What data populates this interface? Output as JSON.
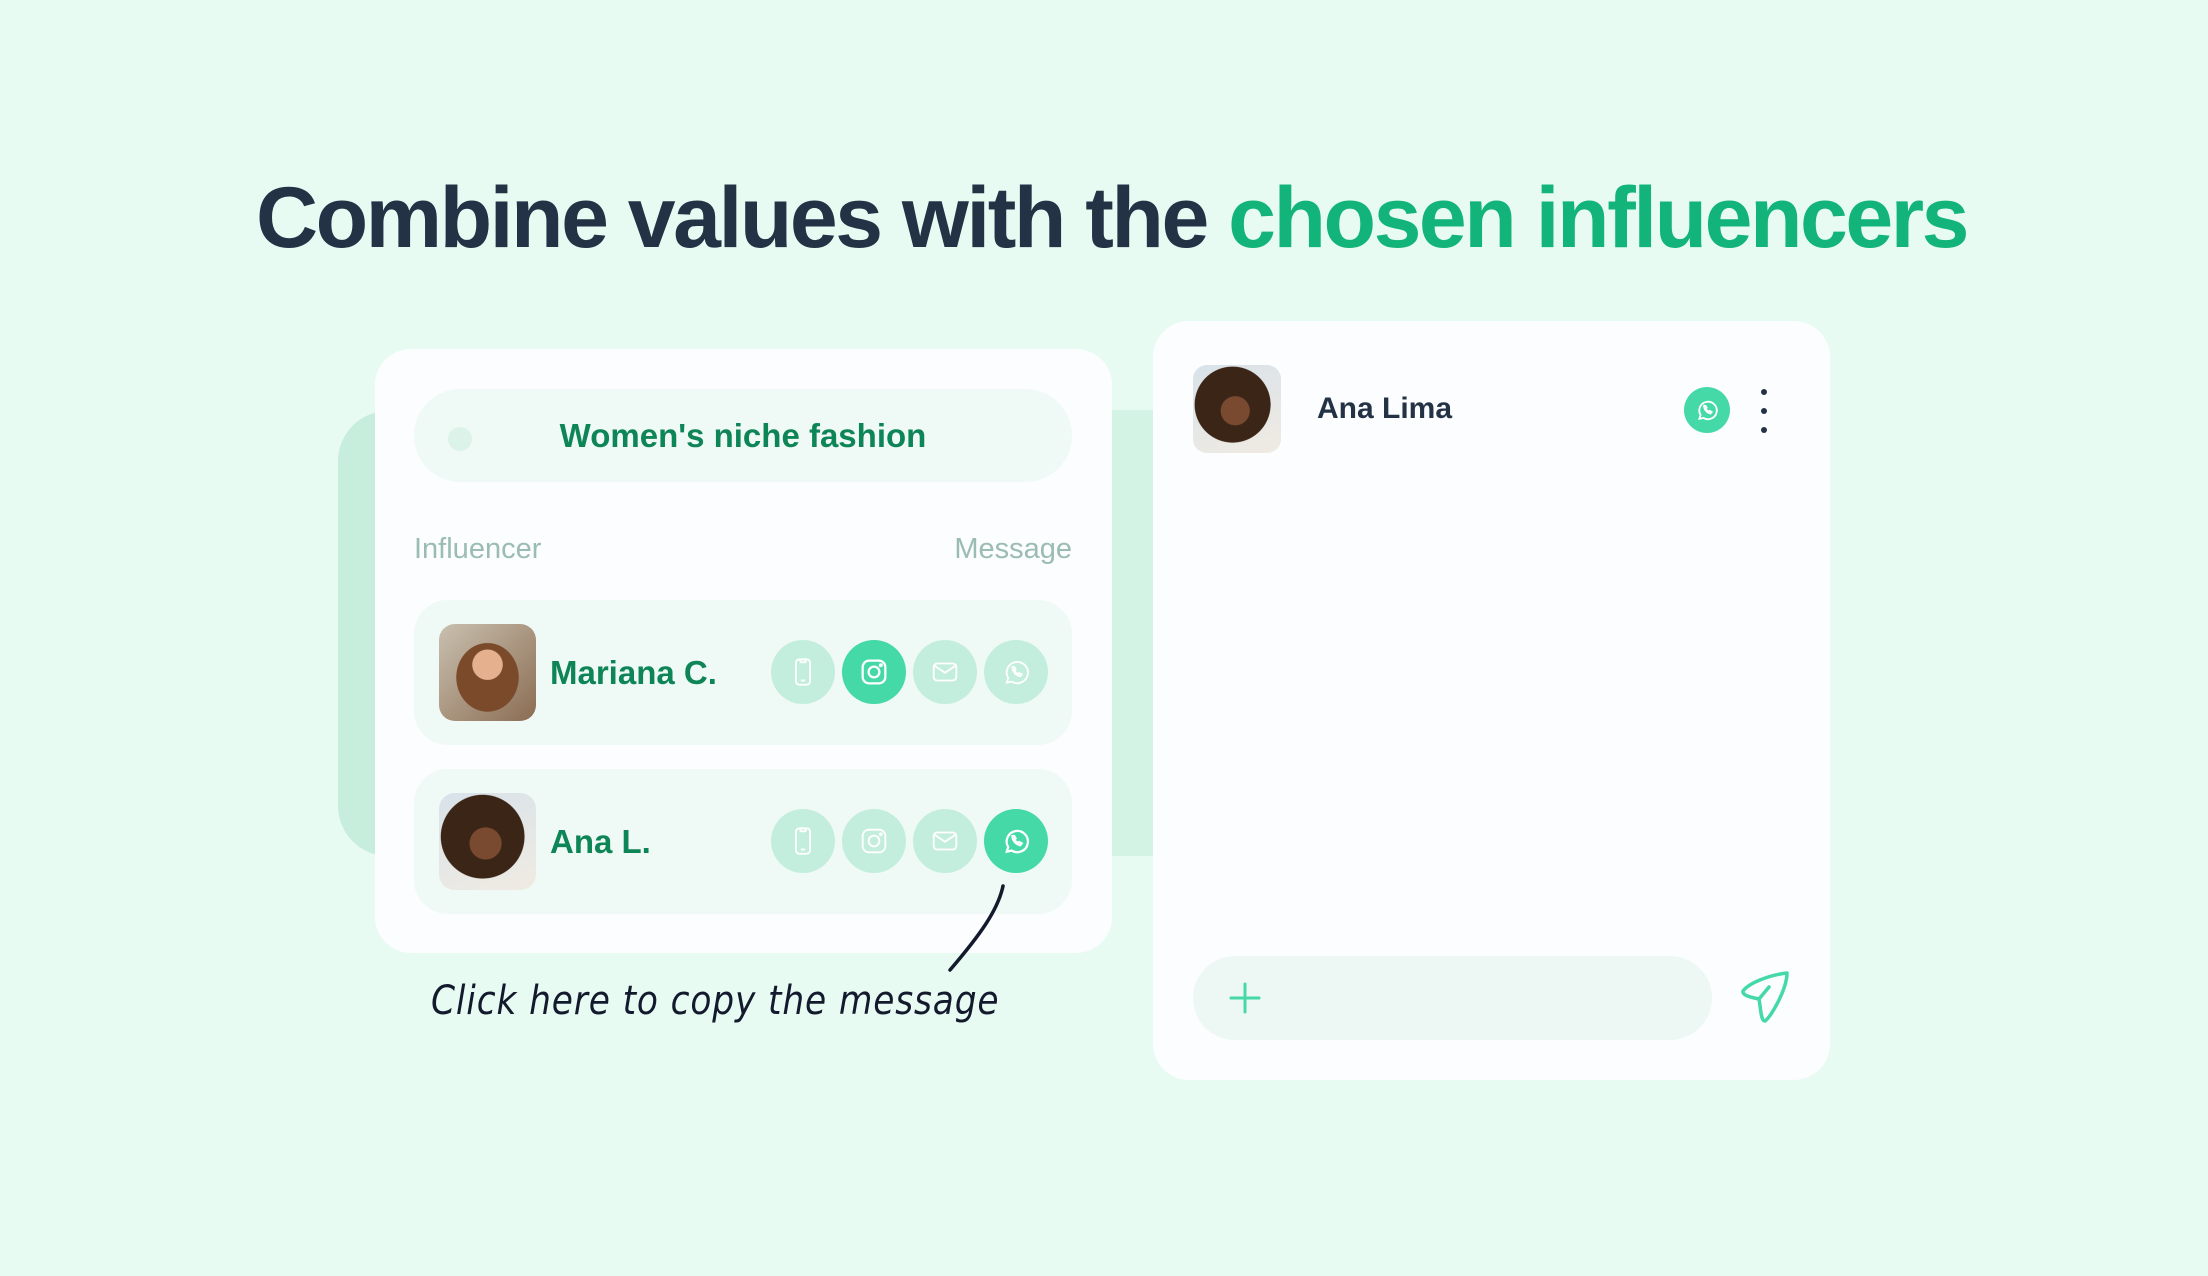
{
  "headline": {
    "part1": "Combine values with the ",
    "part2": "chosen influencers"
  },
  "left_panel": {
    "niche_label": "Women's niche fashion",
    "columns": {
      "influencer": "Influencer",
      "message": "Message"
    },
    "rows": [
      {
        "name": "Mariana C.",
        "channels": [
          "phone-icon",
          "instagram-icon",
          "email-icon",
          "whatsapp-icon"
        ],
        "active_channel": "instagram"
      },
      {
        "name": "Ana L.",
        "channels": [
          "phone-icon",
          "instagram-icon",
          "email-icon",
          "whatsapp-icon"
        ],
        "active_channel": "whatsapp"
      }
    ]
  },
  "annotation": {
    "text": "Click here to copy the message"
  },
  "chat_panel": {
    "contact_name": "Ana Lima",
    "channel": "whatsapp",
    "input_value": ""
  },
  "colors": {
    "accent": "#44d9a6",
    "accent_text": "#0d8556",
    "headline_dark": "#243246",
    "headline_accent": "#12b47a",
    "background": "#e8fbf2"
  }
}
